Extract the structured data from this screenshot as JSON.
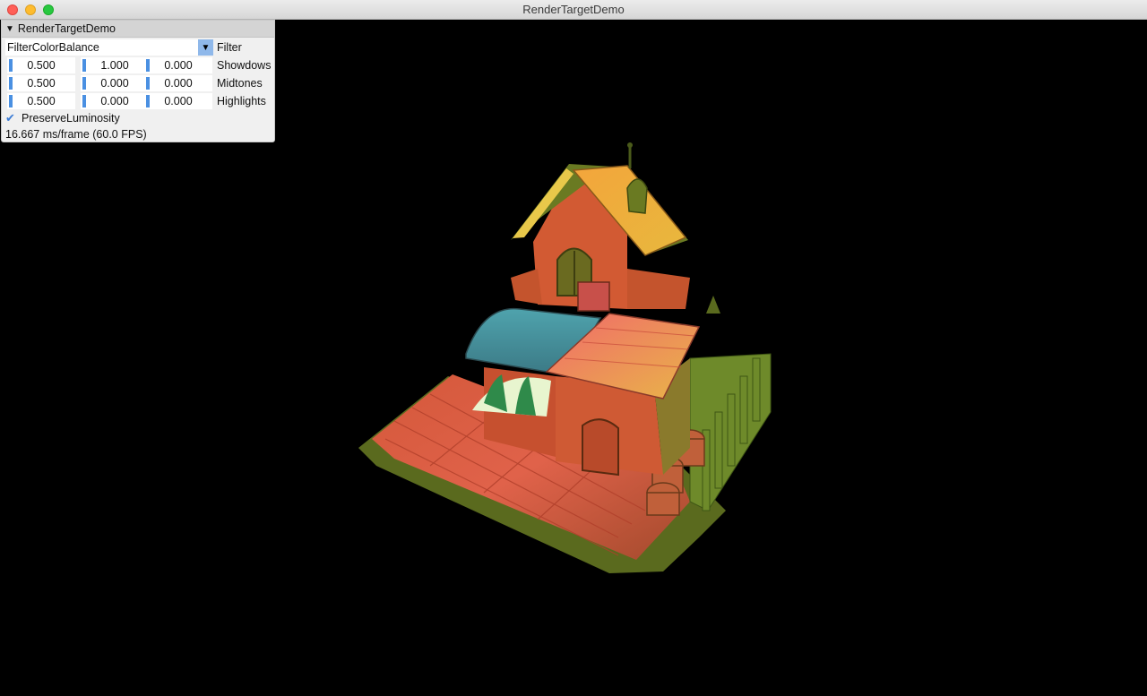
{
  "window": {
    "title": "RenderTargetDemo"
  },
  "panel": {
    "header": "RenderTargetDemo",
    "filter": {
      "selected": "FilterColorBalance",
      "label": "Filter"
    },
    "rows": [
      {
        "label": "Showdows",
        "values": [
          "0.500",
          "1.000",
          "0.000"
        ]
      },
      {
        "label": "Midtones",
        "values": [
          "0.500",
          "0.000",
          "0.000"
        ]
      },
      {
        "label": "Highlights",
        "values": [
          "0.500",
          "0.000",
          "0.000"
        ]
      }
    ],
    "preserve_luminosity": {
      "label": "PreserveLuminosity",
      "checked": true
    },
    "stats": "16.667 ms/frame (60.0 FPS)"
  },
  "colors": {
    "accent": "#4a90e2",
    "combo_button": "#8fb8ea"
  }
}
